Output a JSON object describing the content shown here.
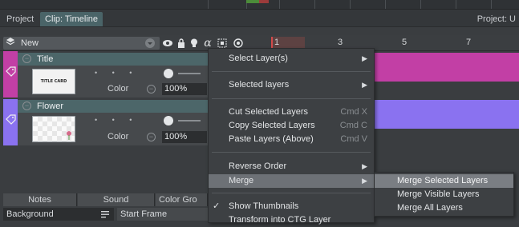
{
  "tabs": {
    "project": "Project",
    "clip": "Clip: Timeline",
    "project_right": "Project: U"
  },
  "header": {
    "new_label": "New",
    "alpha_glyph": "α",
    "ruler": [
      "1",
      "3",
      "5",
      "7"
    ]
  },
  "layers": [
    {
      "name": "Title",
      "thumb_text": "TITLE CARD",
      "color_label": "Color",
      "opacity": "100%",
      "color": "#c23fa5",
      "track_color": "#c23fa5"
    },
    {
      "name": "Flower",
      "color_label": "Color",
      "opacity": "100%",
      "color": "#8a72f0",
      "track_color": "#8a72f0"
    }
  ],
  "bottom_tabs": [
    "Notes",
    "Sound",
    "Color Gro"
  ],
  "bottom_row": {
    "background": "Background",
    "start_frame": "Start Frame"
  },
  "context_menu": {
    "items": [
      {
        "label": "Select Layer(s)",
        "submenu": true
      },
      {
        "label": "Selected layers",
        "submenu": true
      },
      {
        "label": "Cut Selected Layers",
        "shortcut": "Cmd X"
      },
      {
        "label": "Copy Selected Layers",
        "shortcut": "Cmd C"
      },
      {
        "label": "Paste Layers (Above)",
        "shortcut": "Cmd V"
      },
      {
        "label": "Reverse Order",
        "submenu": true
      },
      {
        "label": "Merge",
        "submenu": true,
        "highlighted": true
      },
      {
        "label": "Show Thumbnails",
        "checked": true
      },
      {
        "label": "Transform into CTG Layer"
      }
    ],
    "check_glyph": "✓",
    "arrow_glyph": "▶"
  },
  "merge_submenu": [
    {
      "label": "Merge Selected Layers",
      "highlighted": true
    },
    {
      "label": "Merge Visible Layers"
    },
    {
      "label": "Merge All Layers"
    }
  ],
  "icons": [
    "layers-icon",
    "dropdown-icon",
    "eye-icon",
    "lock-icon",
    "bulb-icon",
    "alpha-icon",
    "grid-icon",
    "camera-icon",
    "tag-icon",
    "minus-icon"
  ]
}
